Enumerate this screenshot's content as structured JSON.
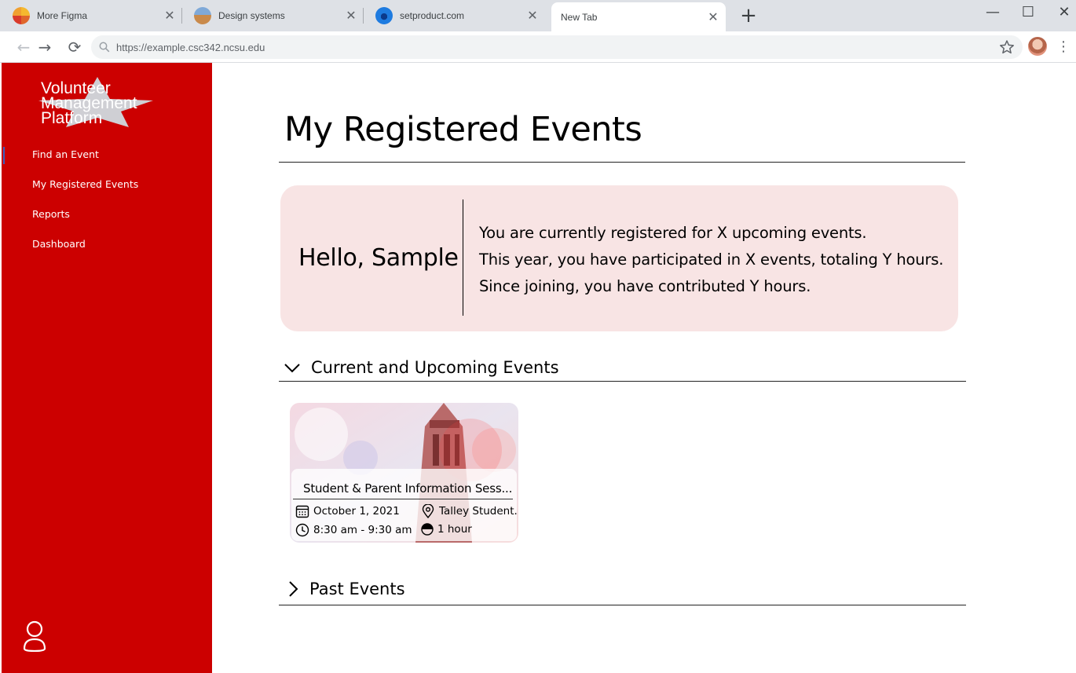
{
  "browser": {
    "tabs": [
      {
        "title": "More Figma",
        "favicon": "figma-favicon"
      },
      {
        "title": "Design systems",
        "favicon": "landscape-favicon"
      },
      {
        "title": "setproduct.com",
        "favicon": "setproduct-favicon"
      },
      {
        "title": "New Tab",
        "favicon": ""
      }
    ],
    "close_glyph": "✕",
    "new_tab_glyph": "+",
    "url": "https://example.csc342.ncsu.edu",
    "window_controls": {
      "minimize": "—",
      "maximize": "☐",
      "close": "✕"
    },
    "nav": {
      "back": "←",
      "forward": "→",
      "reload": "⟳"
    },
    "menu_glyph": "⋮"
  },
  "sidebar": {
    "logo_lines": [
      "Volunteer",
      "Management",
      "Platform"
    ],
    "items": [
      {
        "label": "Find an Event",
        "active": true
      },
      {
        "label": "My Registered Events",
        "active": false
      },
      {
        "label": "Reports",
        "active": false
      },
      {
        "label": "Dashboard",
        "active": false
      }
    ],
    "brand_color": "#cc0000"
  },
  "main": {
    "title": "My Registered Events",
    "summary": {
      "greeting": "Hello, Sample",
      "lines": [
        "You are currently registered for X upcoming events.",
        "This year, you have participated in X events, totaling Y hours.",
        "Since joining, you have contributed Y hours."
      ],
      "background": "#f8e4e4"
    },
    "sections": {
      "upcoming": {
        "label": "Current and Upcoming Events",
        "expanded": true
      },
      "past": {
        "label": "Past Events",
        "expanded": false
      }
    },
    "events": [
      {
        "title": "Student & Parent Information Sess...",
        "date": "October 1, 2021",
        "location": "Talley Student...",
        "time": "8:30 am - 9:30 am",
        "duration": "1 hour"
      }
    ]
  }
}
